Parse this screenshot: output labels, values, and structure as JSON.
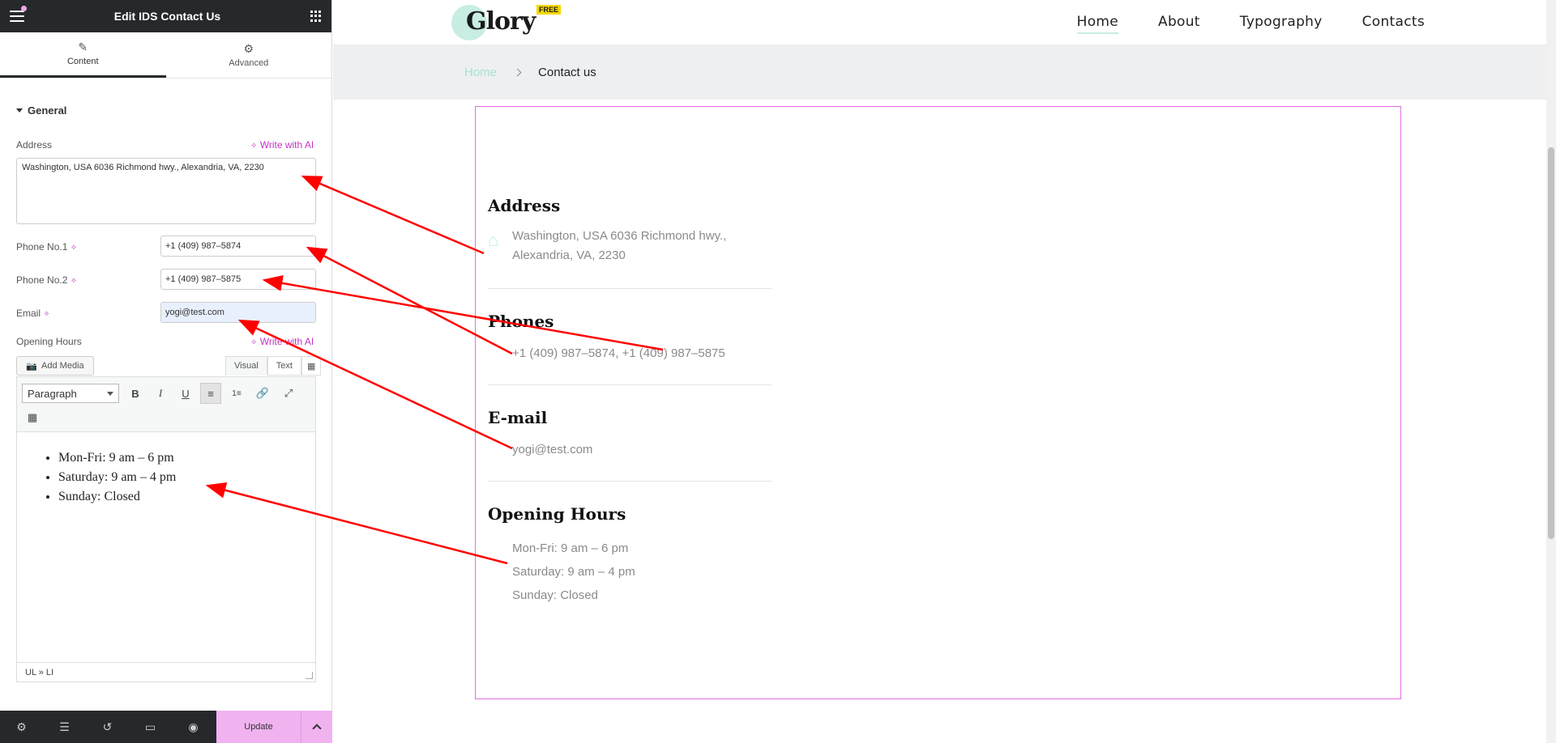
{
  "editor": {
    "title": "Edit IDS Contact Us",
    "tabs": [
      {
        "label": "Content",
        "icon": "pencil-icon"
      },
      {
        "label": "Advanced",
        "icon": "gear-icon"
      }
    ],
    "section": "General",
    "address": {
      "label": "Address",
      "ai": "Write with AI",
      "value": "Washington, USA 6036 Richmond hwy., Alexandria, VA, 2230"
    },
    "phone1": {
      "label": "Phone No.1",
      "value": "+1 (409) 987–5874"
    },
    "phone2": {
      "label": "Phone No.2",
      "value": "+1 (409) 987–5875"
    },
    "email": {
      "label": "Email",
      "value": "yogi@test.com"
    },
    "hours": {
      "label": "Opening Hours",
      "ai": "Write with AI",
      "add_media": "Add Media",
      "mode_visual": "Visual",
      "mode_text": "Text",
      "format": "Paragraph",
      "items": [
        "Mon-Fri: 9 am – 6 pm",
        "Saturday: 9 am – 4 pm",
        "Sunday: Closed"
      ],
      "status": "UL » LI"
    },
    "bottom": {
      "update": "Update"
    }
  },
  "site": {
    "logo": "Glory",
    "badge": "FREE",
    "nav": [
      "Home",
      "About",
      "Typography",
      "Contacts"
    ],
    "crumb_home": "Home",
    "crumb_current": "Contact us",
    "address_heading": "Address",
    "address_line1": "Washington, USA 6036 Richmond hwy.,",
    "address_line2": "Alexandria, VA, 2230",
    "phones_heading": "Phones",
    "phones": "+1 (409) 987–5874, +1 (409) 987–5875",
    "email_heading": "E-mail",
    "email": "yogi@test.com",
    "hours_heading": "Opening Hours",
    "hours": [
      "Mon-Fri: 9 am – 6 pm",
      "Saturday: 9 am – 4 pm",
      "Sunday: Closed"
    ]
  },
  "colors": {
    "accent_pink": "#c334c3",
    "update_bg": "#f0b3f0",
    "mint": "#c8ede3",
    "annotation_red": "#ff0000"
  }
}
